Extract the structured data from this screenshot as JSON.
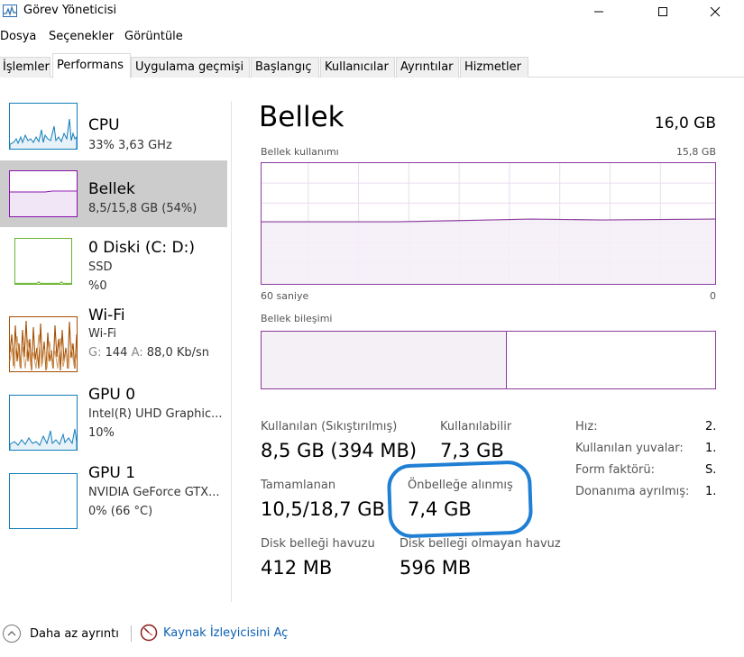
{
  "window": {
    "title": "Görev Yöneticisi"
  },
  "menu": [
    "Dosya",
    "Seçenekler",
    "Görüntüle"
  ],
  "tabs": [
    {
      "label": "İşlemler",
      "active": false
    },
    {
      "label": "Performans",
      "active": true
    },
    {
      "label": "Uygulama geçmişi",
      "active": false
    },
    {
      "label": "Başlangıç",
      "active": false
    },
    {
      "label": "Kullanıcılar",
      "active": false
    },
    {
      "label": "Ayrıntılar",
      "active": false
    },
    {
      "label": "Hizmetler",
      "active": false
    }
  ],
  "sidebar": {
    "items": [
      {
        "title": "CPU",
        "lines": [
          "33% 3,63 GHz"
        ],
        "color": "#117dbb",
        "selected": false
      },
      {
        "title": "Bellek",
        "lines": [
          "8,5/15,8 GB (54%)"
        ],
        "color": "#8b12ae",
        "selected": true
      },
      {
        "title": "0 Diski (C: D:)",
        "lines": [
          "SSD",
          "%0"
        ],
        "color": "#4da60c",
        "selected": false
      },
      {
        "title": "Wi-Fi",
        "lines": [
          "Wi-Fi"
        ],
        "wifi_line": {
          "g_label": "G:",
          "g_value": "144",
          "a_label": "A:",
          "a_value": "88,0 Kb/sn"
        },
        "color": "#a74f01",
        "selected": false
      },
      {
        "title": "GPU 0",
        "lines": [
          "Intel(R) UHD Graphic...",
          "10%"
        ],
        "color": "#117dbb",
        "selected": false
      },
      {
        "title": "GPU 1",
        "lines": [
          "NVIDIA GeForce GTX...",
          "0% (66 °C)"
        ],
        "color": "#117dbb",
        "selected": false
      }
    ]
  },
  "main": {
    "title": "Bellek",
    "total": "16,0 GB",
    "usage_label": "Bellek kullanımı",
    "usage_max": "15,8 GB",
    "time_left": "60 saniye",
    "time_right": "0",
    "composition_label": "Bellek bileşimi",
    "composition_used_fraction": 0.54,
    "stats": {
      "in_use": {
        "label": "Kullanılan (Sıkıştırılmış)",
        "value": "8,5 GB (394 MB)"
      },
      "available": {
        "label": "Kullanılabilir",
        "value": "7,3 GB"
      },
      "committed": {
        "label": "Tamamlanan",
        "value": "10,5/18,7 GB"
      },
      "cached": {
        "label": "Önbelleğe alınmış",
        "value": "7,4 GB"
      },
      "paged_pool": {
        "label": "Disk belleği havuzu",
        "value": "412 MB"
      },
      "nonpaged_pool": {
        "label": "Disk belleği olmayan havuz",
        "value": "596 MB"
      }
    },
    "properties": [
      {
        "label": "Hız:",
        "value": "2."
      },
      {
        "label": "Kullanılan yuvalar:",
        "value": "1."
      },
      {
        "label": "Form faktörü:",
        "value": "S."
      },
      {
        "label": "Donanıma ayrılmış:",
        "value": "1."
      }
    ]
  },
  "bottom": {
    "fewer_details": "Daha az ayrıntı",
    "resource_monitor": "Kaynak İzleyicisini Aç"
  },
  "colors": {
    "memory": "#8b3c9e",
    "highlight": "#1f7fd4",
    "link": "#0b5fb6"
  }
}
